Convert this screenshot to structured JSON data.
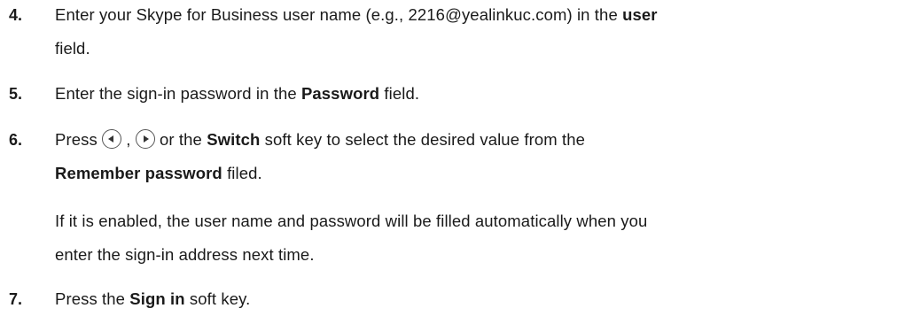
{
  "steps": [
    {
      "number": "4.",
      "line1_a": "Enter your Skype for Business user name (e.g., 2216@yealinkuc.com) in the ",
      "line1_bold": "user",
      "line2": "field."
    },
    {
      "number": "5.",
      "text_a": "Enter the sign-in password in the ",
      "bold": "Password",
      "text_b": " field."
    },
    {
      "number": "6.",
      "press": "Press",
      "sep": ",",
      "text_or": " or the ",
      "bold_switch": "Switch",
      "text_after_switch": " soft key to select the desired value from the",
      "bold_remember": "Remember password",
      "text_filed": " filed.",
      "note_line1": "If it is enabled, the user name and password will be filled automatically when you",
      "note_line2": "enter the sign-in address next time.",
      "key_left_icon": "left-navigation-key-icon",
      "key_right_icon": "right-navigation-key-icon"
    },
    {
      "number": "7.",
      "text_a": "Press the ",
      "bold": "Sign in",
      "text_b": " soft key."
    }
  ]
}
